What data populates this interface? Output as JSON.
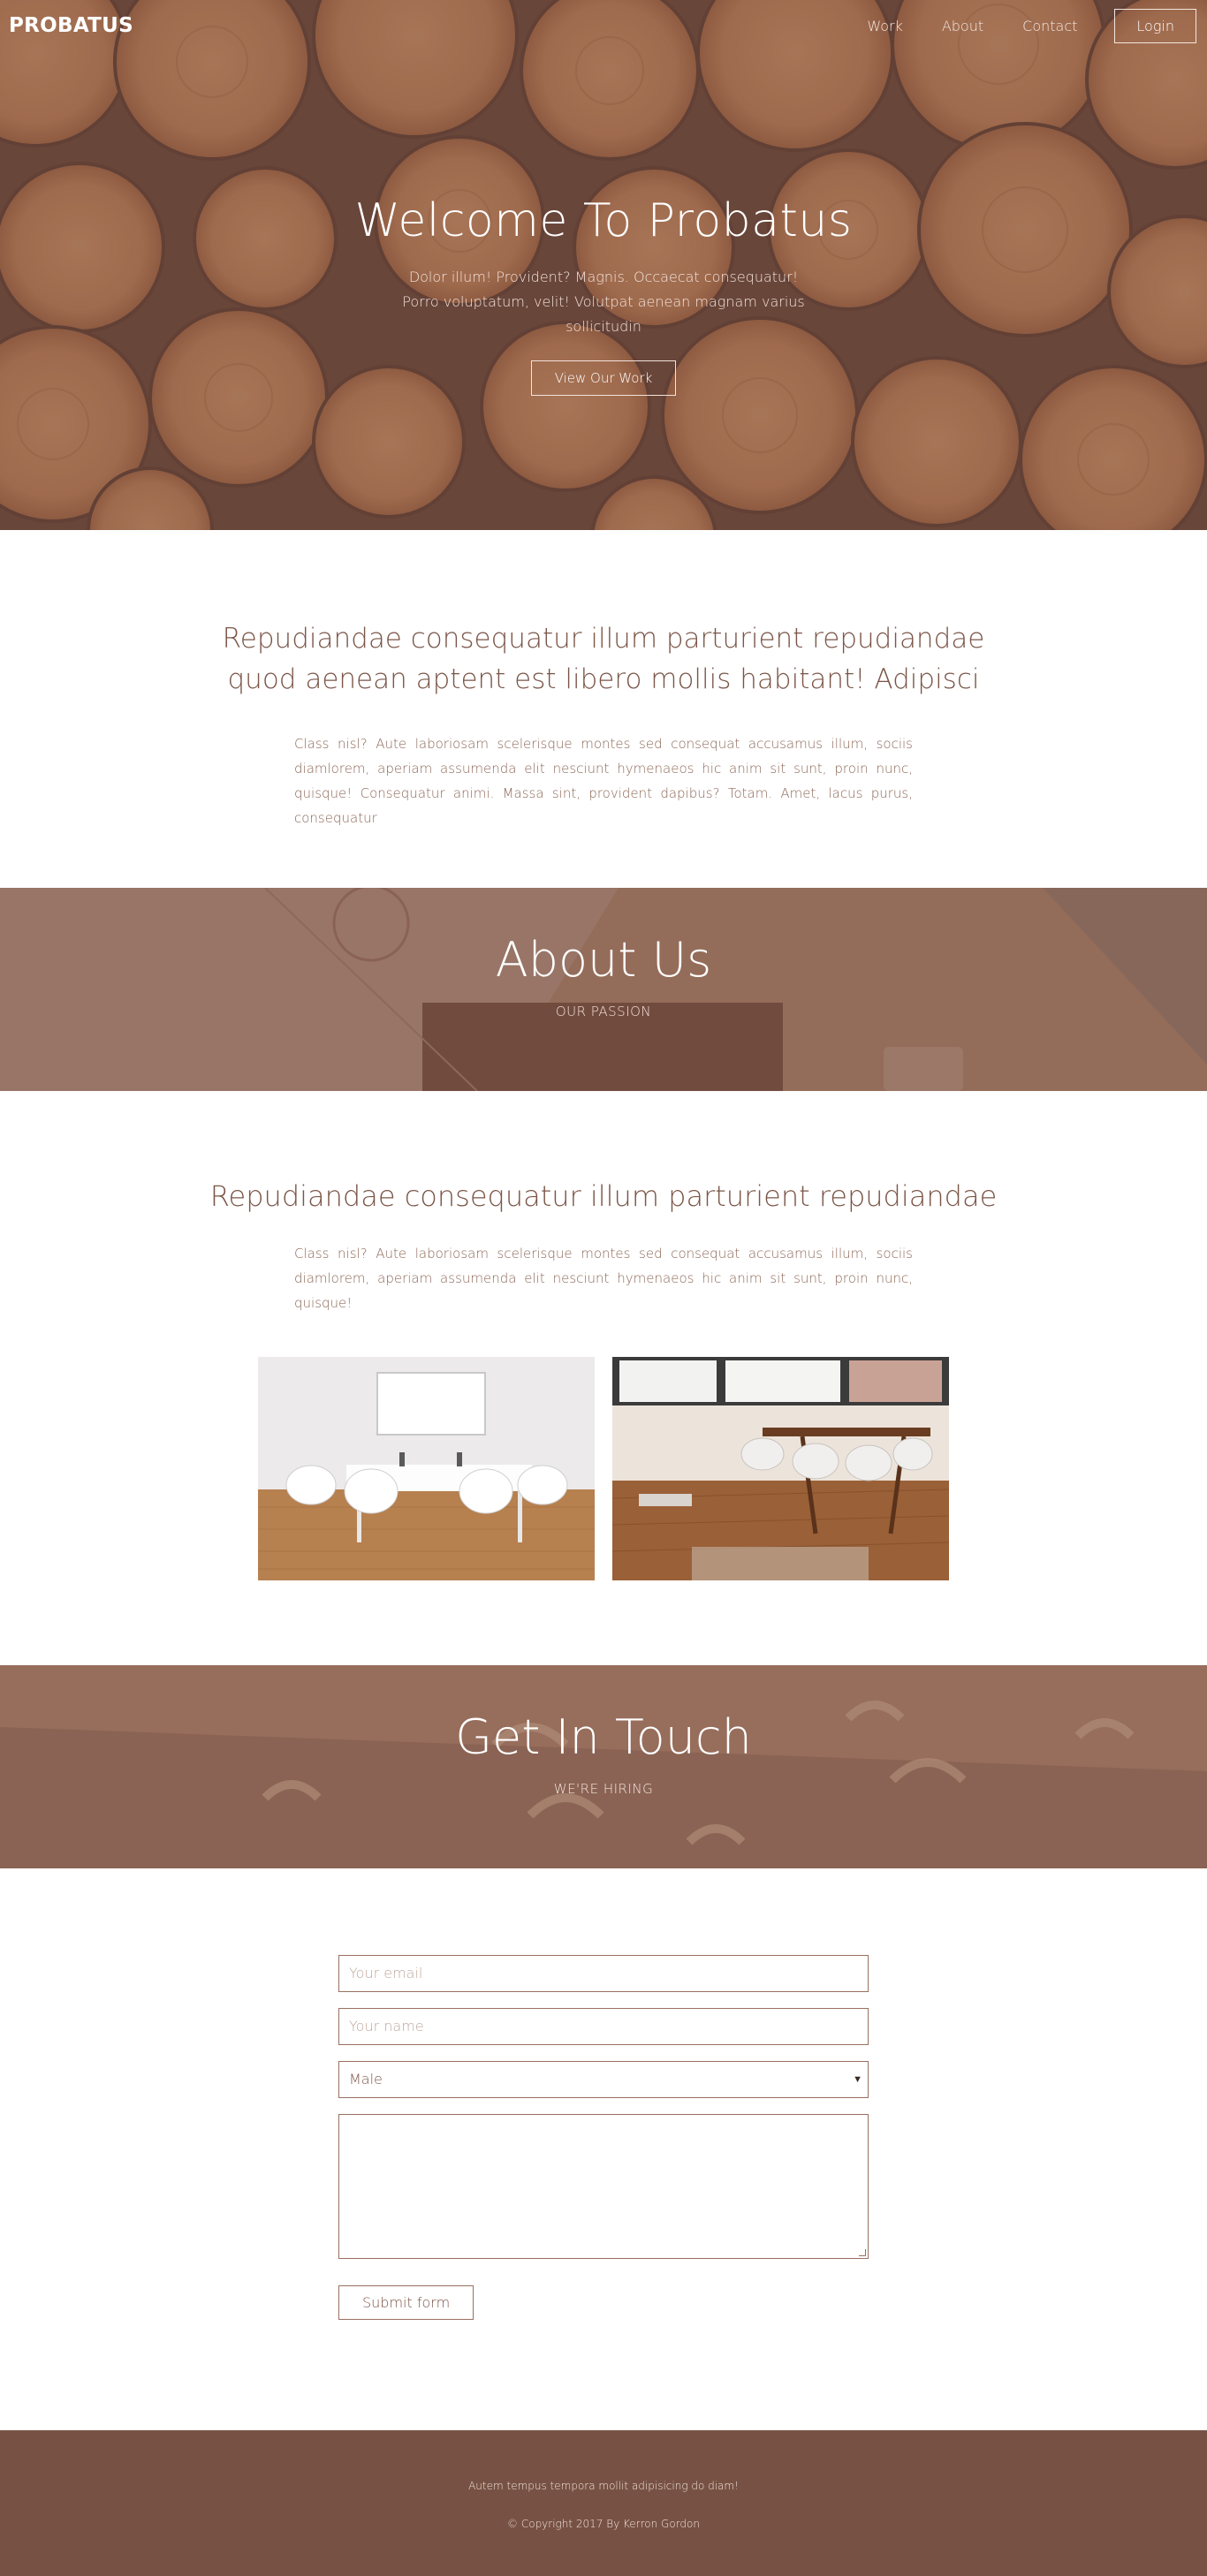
{
  "nav": {
    "brand": "PROBATUS",
    "links": [
      "Work",
      "About",
      "Contact"
    ],
    "login": "Login"
  },
  "hero": {
    "title": "Welcome To Probatus",
    "subtitle": "Dolor illum! Provident? Magnis. Occaecat consequatur! Porro voluptatum, velit! Volutpat aenean magnam varius sollicitudin",
    "button": "View Our Work"
  },
  "intro": {
    "title": "Repudiandae consequatur illum parturient repudiandae quod aenean aptent est libero mollis habitant! Adipisci",
    "text": "Class nisl? Aute laboriosam scelerisque montes sed consequat accusamus illum, sociis diamlorem, aperiam assumenda elit nesciunt hymenaeos hic anim sit sunt, proin nunc, quisque! Consequatur animi. Massa sint, provident dapibus? Totam. Amet, lacus purus, consequatur"
  },
  "about_banner": {
    "title": "About Us",
    "subtitle": "OUR PASSION"
  },
  "about": {
    "title": "Repudiandae consequatur illum parturient repudiandae",
    "text": "Class nisl? Aute laboriosam scelerisque montes sed consequat accusamus illum, sociis diamlorem, aperiam assumenda elit nesciunt hymenaeos hic anim sit sunt, proin nunc, quisque!"
  },
  "contact_banner": {
    "title": "Get In Touch",
    "subtitle": "WE'RE HIRING"
  },
  "form": {
    "email_placeholder": "Your email",
    "name_placeholder": "Your name",
    "gender_value": "Male",
    "submit": "Submit form"
  },
  "footer": {
    "tagline": "Autem tempus tempora mollit adipisicing do diam!",
    "copyright": "© Copyright 2017 By Kerron Gordon"
  },
  "colors": {
    "accent": "#775244",
    "text": "#7a5547",
    "border": "#9b6f60"
  }
}
